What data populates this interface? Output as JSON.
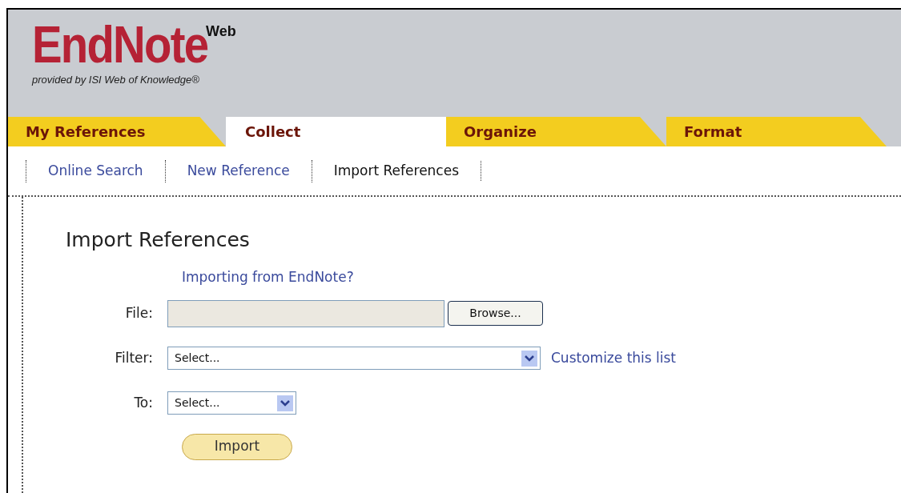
{
  "logo": {
    "name": "EndNote",
    "superscript": "Web",
    "tagline": "provided by ISI Web of Knowledge®"
  },
  "tabs": [
    {
      "label": "My References",
      "selected": false
    },
    {
      "label": "Collect",
      "selected": true
    },
    {
      "label": "Organize",
      "selected": false
    },
    {
      "label": "Format",
      "selected": false
    }
  ],
  "subnav": [
    {
      "label": "Online Search",
      "selected": false
    },
    {
      "label": "New Reference",
      "selected": false
    },
    {
      "label": "Import References",
      "selected": true
    }
  ],
  "heading": "Import References",
  "help_link": "Importing from EndNote?",
  "fields": [
    {
      "kind": "file",
      "label": "File:",
      "button": "Browse..."
    },
    {
      "kind": "select",
      "label": "Filter:",
      "value": "Select...",
      "link": "Customize this list"
    },
    {
      "kind": "select",
      "label": "To:",
      "value": "Select..."
    }
  ],
  "submit": "Import"
}
